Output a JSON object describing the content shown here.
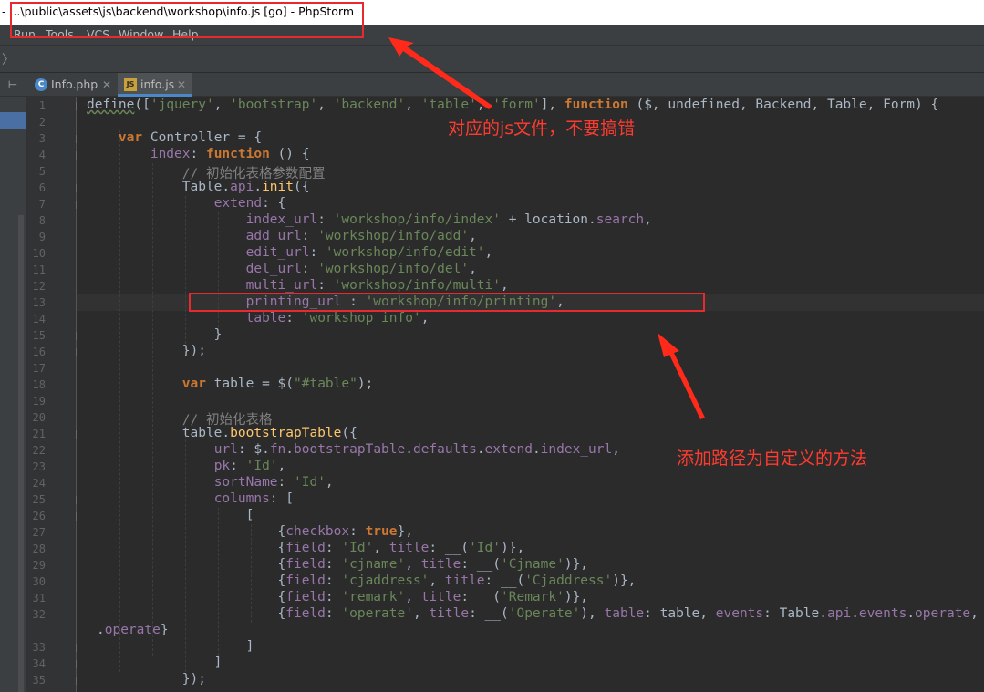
{
  "window": {
    "title": "- ...\\public\\assets\\js\\backend\\workshop\\info.js [go] - PhpStorm"
  },
  "menu": {
    "items": [
      "Run",
      "Tools",
      "VCS",
      "Window",
      "Help"
    ]
  },
  "navbar": {
    "arrow": "〉"
  },
  "tabs": [
    {
      "label": "Info.php",
      "icon": "php-class-icon",
      "active": false
    },
    {
      "label": "info.js",
      "icon": "js-file-icon",
      "active": true
    }
  ],
  "editor": {
    "line_numbers": [
      "1",
      "2",
      "3",
      "4",
      "5",
      "6",
      "7",
      "8",
      "9",
      "10",
      "11",
      "12",
      "13",
      "14",
      "15",
      "16",
      "17",
      "18",
      "19",
      "20",
      "21",
      "22",
      "23",
      "24",
      "25",
      "26",
      "27",
      "28",
      "29",
      "30",
      "31",
      "32",
      "",
      "33",
      "34",
      "35"
    ],
    "lines": [
      "define(['jquery', 'bootstrap', 'backend', 'table', 'form'], function ($, undefined, Backend, Table, Form) {",
      "",
      "    var Controller = {",
      "        index: function () {",
      "            // 初始化表格参数配置",
      "            Table.api.init({",
      "                extend: {",
      "                    index_url: 'workshop/info/index' + location.search,",
      "                    add_url: 'workshop/info/add',",
      "                    edit_url: 'workshop/info/edit',",
      "                    del_url: 'workshop/info/del',",
      "                    multi_url: 'workshop/info/multi',",
      "                    printing_url : 'workshop/info/printing',",
      "                    table: 'workshop_info',",
      "                }",
      "            });",
      "",
      "            var table = $(\"#table\");",
      "",
      "            // 初始化表格",
      "            table.bootstrapTable({",
      "                url: $.fn.bootstrapTable.defaults.extend.index_url,",
      "                pk: 'Id',",
      "                sortName: 'Id',",
      "                columns: [",
      "                    [",
      "                        {checkbox: true},",
      "                        {field: 'Id', title: __('Id')},",
      "                        {field: 'cjname', title: __('Cjname')},",
      "                        {field: 'cjaddress', title: __('Cjaddress')},",
      "                        {field: 'remark', title: __('Remark')},",
      "                        {field: 'operate', title: __('Operate'), table: table, events: Table.api.events.operate, formatter: Table.api.formatter",
      ".operate}",
      "                    ]",
      "                ]",
      "            });"
    ]
  },
  "annotations": {
    "js_file_note": "对应的js文件，不要搞错",
    "custom_path_note": "添加路径为自定义的方法"
  },
  "colors": {
    "keyword": "#cc7832",
    "string": "#6a8759",
    "property": "#9876aa",
    "function_name": "#ffc66d",
    "comment": "#808080",
    "annotation": "#e8292e",
    "tab_active_underline": "#4a88c7"
  }
}
